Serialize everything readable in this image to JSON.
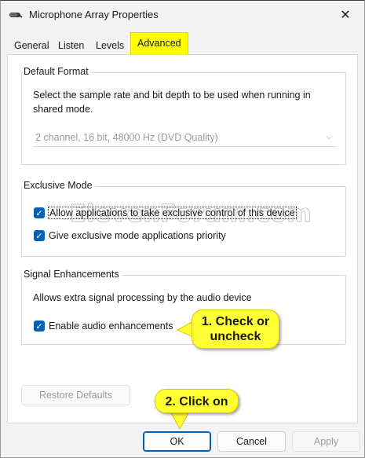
{
  "window": {
    "title": "Microphone Array Properties",
    "icon": "microphone-icon",
    "close_glyph": "✕"
  },
  "tabs": [
    {
      "label": "General",
      "active": false
    },
    {
      "label": "Listen",
      "active": false
    },
    {
      "label": "Levels",
      "active": false
    },
    {
      "label": "Advanced",
      "active": true
    }
  ],
  "default_format": {
    "title": "Default Format",
    "description_line1": "Select the sample rate and bit depth to be used when running in",
    "description_line2": "shared mode.",
    "selected": "2 channel, 16 bit, 48000 Hz (DVD Quality)",
    "enabled": false
  },
  "exclusive_mode": {
    "title": "Exclusive Mode",
    "allow_label": "Allow applications to take exclusive control of this device",
    "allow_checked": true,
    "priority_label": "Give exclusive mode applications priority",
    "priority_checked": true
  },
  "signal_enhancements": {
    "title": "Signal Enhancements",
    "description": "Allows extra signal processing by the audio device",
    "enable_label": "Enable audio enhancements",
    "enable_checked": true
  },
  "buttons": {
    "restore_defaults": "Restore Defaults",
    "ok": "OK",
    "cancel": "Cancel",
    "apply": "Apply"
  },
  "watermark": "ElevenForum.com",
  "callouts": {
    "step1_line1": "1. Check or",
    "step1_line2": "uncheck",
    "step2": "2. Click on"
  },
  "colors": {
    "highlight": "#ffff00",
    "checkbox_accent": "#005fb8"
  }
}
